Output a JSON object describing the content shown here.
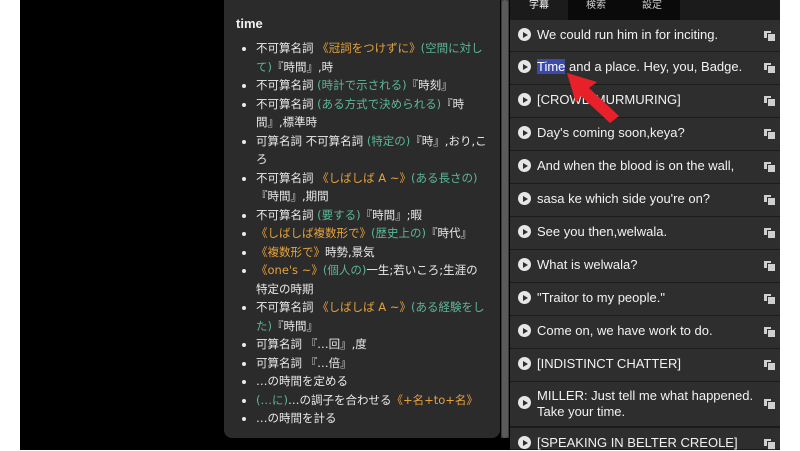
{
  "dictionary": {
    "word": "time",
    "entries": [
      [
        {
          "t": "不可算名詞 ",
          "c": "w"
        },
        {
          "t": "《冠詞をつけずに》",
          "c": "o"
        },
        {
          "t": "(空間に対して)",
          "c": "g"
        },
        {
          "t": "『時間』,時",
          "c": "w"
        }
      ],
      [
        {
          "t": "不可算名詞 ",
          "c": "w"
        },
        {
          "t": "(時計で示される)",
          "c": "g"
        },
        {
          "t": "『時刻』",
          "c": "w"
        }
      ],
      [
        {
          "t": "不可算名詞 ",
          "c": "w"
        },
        {
          "t": "(ある方式で決められる)",
          "c": "g"
        },
        {
          "t": "『時間』,標準時",
          "c": "w"
        }
      ],
      [
        {
          "t": "可算名詞 不可算名詞 ",
          "c": "w"
        },
        {
          "t": "(特定の)",
          "c": "g"
        },
        {
          "t": "『時』,おり,ころ",
          "c": "w"
        }
      ],
      [
        {
          "t": "不可算名詞 ",
          "c": "w"
        },
        {
          "t": "《しばしば A ~》",
          "c": "o"
        },
        {
          "t": "(ある長さの)",
          "c": "g"
        },
        {
          "t": "『時間』,期間",
          "c": "w"
        }
      ],
      [
        {
          "t": "不可算名詞 ",
          "c": "w"
        },
        {
          "t": "(要する)",
          "c": "g"
        },
        {
          "t": "『時間』;暇",
          "c": "w"
        }
      ],
      [
        {
          "t": "《しばしば複数形で》",
          "c": "o"
        },
        {
          "t": "(歴史上の)",
          "c": "g"
        },
        {
          "t": "『時代』",
          "c": "w"
        }
      ],
      [
        {
          "t": "《複数形で》",
          "c": "o"
        },
        {
          "t": "時勢,景気",
          "c": "w"
        }
      ],
      [
        {
          "t": "《one's ~》",
          "c": "o"
        },
        {
          "t": "(個人の)",
          "c": "g"
        },
        {
          "t": "一生;若いころ;生涯の特定の時期",
          "c": "w"
        }
      ],
      [
        {
          "t": "不可算名詞 ",
          "c": "w"
        },
        {
          "t": "《しばしば A ~》",
          "c": "o"
        },
        {
          "t": "(ある経験をした)",
          "c": "g"
        },
        {
          "t": "『時間』",
          "c": "w"
        }
      ],
      [
        {
          "t": "可算名詞 『…回』,度",
          "c": "w"
        }
      ],
      [
        {
          "t": "可算名詞 『…倍』",
          "c": "w"
        }
      ],
      [
        {
          "t": "…の時間を定める",
          "c": "w"
        }
      ],
      [
        {
          "t": "(…に)",
          "c": "g"
        },
        {
          "t": "…の調子を合わせる",
          "c": "w"
        },
        {
          "t": "《+名+to+名》",
          "c": "o"
        }
      ],
      [
        {
          "t": "…の時間を計る",
          "c": "w"
        }
      ]
    ]
  },
  "tabs": [
    "字幕",
    "検索",
    "設定"
  ],
  "subtitles": [
    "We could run him in for inciting.",
    "and a place. Hey, you, Badge.",
    "[CROWD MURMURING]",
    "Day's coming soon,keya?",
    "And when the blood is on the wall,",
    "sasa ke which side you're on?",
    "See you then,welwala.",
    "What is welwala?",
    "\"Traitor to my people.\"",
    "Come on, we have work to do.",
    "[INDISTINCT CHATTER]",
    "MILLER: Just tell me what happened.\nTake your time.",
    "[SPEAKING IN BELTER CREOLE]"
  ],
  "highlight_word": "Time",
  "colors": {
    "orange": "#e5a23b",
    "green": "#5bb69a",
    "highlight": "#3b4aa8",
    "arrow": "#e8202a"
  }
}
